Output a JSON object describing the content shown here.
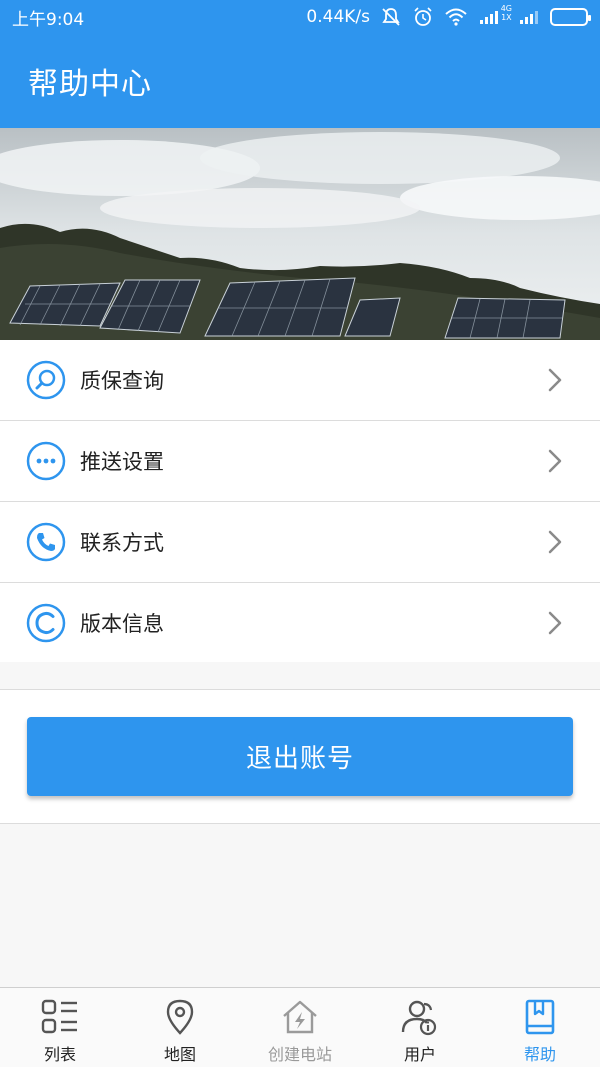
{
  "status_bar": {
    "time": "上午9:04",
    "speed": "0.44K/s",
    "network_4g": "4G",
    "network_1x": "1X"
  },
  "header": {
    "title": "帮助中心"
  },
  "menu": {
    "items": [
      {
        "label": "质保查询",
        "icon": "search-icon"
      },
      {
        "label": "推送设置",
        "icon": "more-dots-icon"
      },
      {
        "label": "联系方式",
        "icon": "phone-icon"
      },
      {
        "label": "版本信息",
        "icon": "copyright-icon"
      }
    ]
  },
  "logout": {
    "label": "退出账号"
  },
  "tabs": [
    {
      "label": "列表",
      "icon": "list-icon",
      "state": "normal"
    },
    {
      "label": "地图",
      "icon": "map-pin-icon",
      "state": "normal"
    },
    {
      "label": "创建电站",
      "icon": "create-station-icon",
      "state": "disabled"
    },
    {
      "label": "用户",
      "icon": "user-icon",
      "state": "normal"
    },
    {
      "label": "帮助",
      "icon": "help-book-icon",
      "state": "active"
    }
  ],
  "colors": {
    "primary": "#2e95ee",
    "text": "#222222",
    "disabled": "#9a9a9a",
    "divider": "#dcdcdc"
  }
}
